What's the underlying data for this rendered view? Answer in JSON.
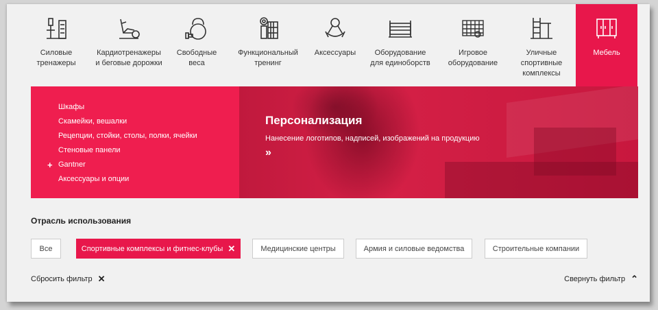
{
  "nav": {
    "categories": [
      {
        "label": "Силовые\nтренажеры",
        "icon": "weight-machine-icon"
      },
      {
        "label": "Кардиотренажеры\nи беговые дорожки",
        "icon": "exercise-bike-icon"
      },
      {
        "label": "Свободные\nвеса",
        "icon": "kettlebell-icon"
      },
      {
        "label": "Функциональный\nтренинг",
        "icon": "functional-rack-icon"
      },
      {
        "label": "Аксессуары",
        "icon": "jump-rope-icon"
      },
      {
        "label": "Оборудование\nдля единоборств",
        "icon": "boxing-ring-icon"
      },
      {
        "label": "Игровое\nоборудование",
        "icon": "goal-net-icon"
      },
      {
        "label": "Уличные\nспортивные\nкомплексы",
        "icon": "outdoor-bars-icon"
      },
      {
        "label": "Мебель",
        "icon": "wardrobe-icon"
      }
    ]
  },
  "menu": {
    "items": [
      {
        "label": "Шкафы"
      },
      {
        "label": "Скамейки, вешалки"
      },
      {
        "label": "Рецепции, стойки, столы, полки, ячейки"
      },
      {
        "label": "Стеновые панели"
      },
      {
        "label": "Gantner",
        "plus": "+"
      },
      {
        "label": "Аксессуары и опции"
      }
    ]
  },
  "promo": {
    "title": "Персонализация",
    "subtitle": "Нанесение логотипов, надписей, изображений на продукцию",
    "arrow": "»"
  },
  "filter": {
    "title": "Отрасль использования",
    "chips": [
      {
        "label": "Все"
      },
      {
        "label": "Спортивные комплексы и фитнес-клубы",
        "close": "✕"
      },
      {
        "label": "Медицинские центры"
      },
      {
        "label": "Армия и силовые ведомства"
      },
      {
        "label": "Строительные компании"
      }
    ],
    "reset_label": "Сбросить фильтр",
    "reset_icon": "✕",
    "collapse_label": "Свернуть фильтр",
    "collapse_icon": "⌃"
  },
  "colors": {
    "accent": "#e8174b",
    "background": "#f1f1f1"
  }
}
